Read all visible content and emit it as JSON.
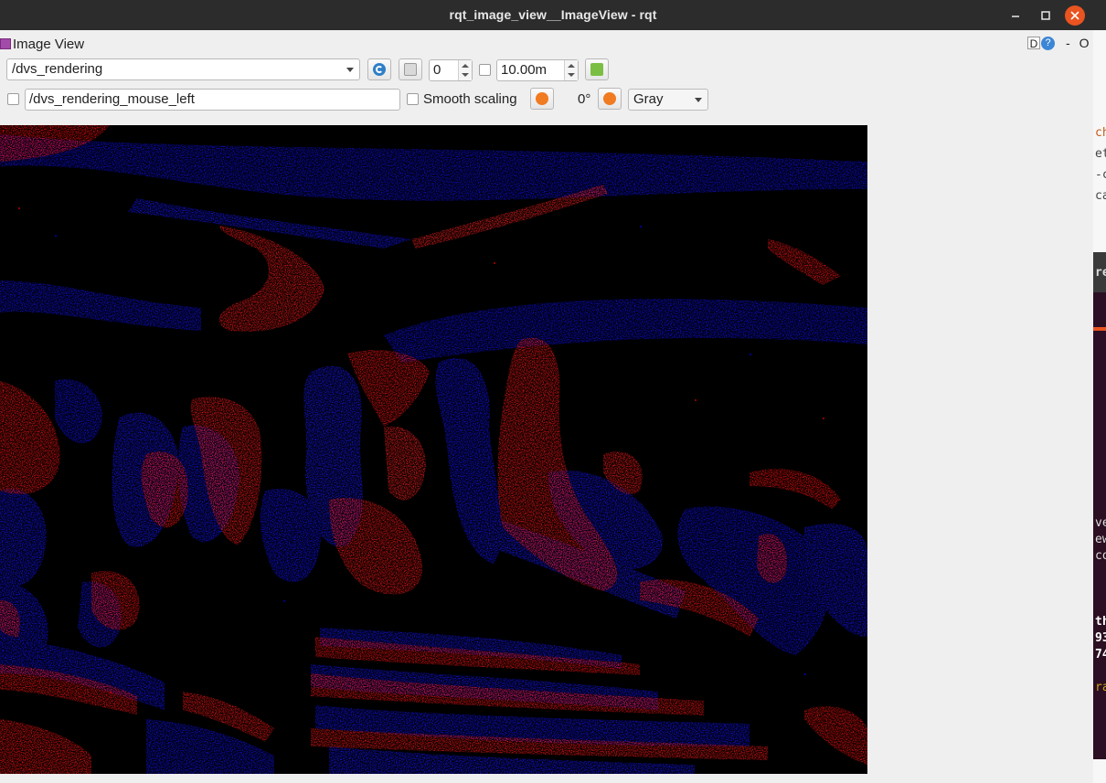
{
  "window": {
    "title": "rqt_image_view__ImageView - rqt"
  },
  "panel": {
    "title": "Image View",
    "dock_label": "D",
    "help_label": "?",
    "minimize_label": "-",
    "close_label": "O"
  },
  "toolbar": {
    "topic": "/dvs_rendering",
    "count_value": "0",
    "duration_value": "10.00m",
    "publish_topic": "/dvs_rendering_mouse_left",
    "smooth_scaling_label": "Smooth scaling",
    "rotation_label": "0°",
    "color_scheme": "Gray"
  },
  "image": {
    "description_colors": {
      "background": "#000000",
      "positive": "#ff0000",
      "negative": "#0000ff"
    }
  },
  "background_window": {
    "fragments": [
      "ch",
      "et",
      "-c",
      "ca",
      "re",
      "ve",
      "ew",
      "co",
      "th",
      "93",
      "74",
      "ra"
    ]
  }
}
